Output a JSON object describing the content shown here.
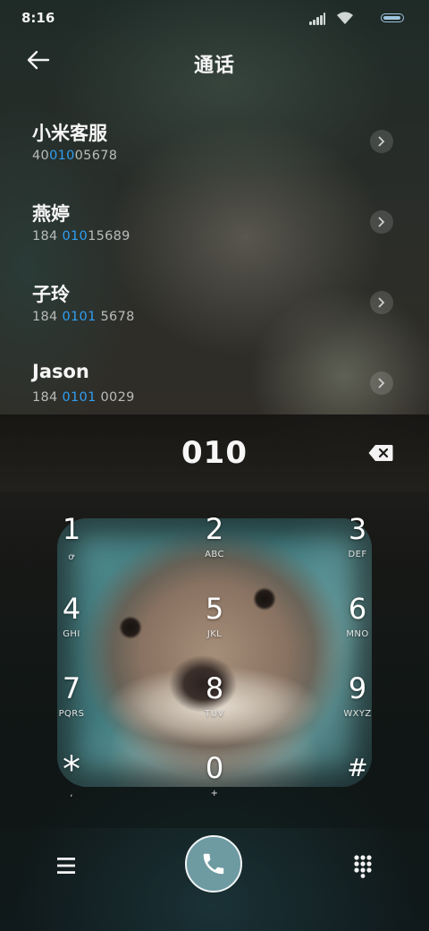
{
  "status_bar": {
    "time": "8:16",
    "icons": [
      "signal-icon",
      "wifi-icon",
      "battery-icon"
    ],
    "battery_color": "#9fc4df"
  },
  "header": {
    "title": "通话",
    "back_icon": "arrow-left-icon"
  },
  "contacts": [
    {
      "name": "小米客服",
      "number_pre": "40",
      "number_match": "010",
      "number_post": "05678"
    },
    {
      "name": "燕婷",
      "number_pre": "184 ",
      "number_match": "010",
      "number_post": "15689"
    },
    {
      "name": "子玲",
      "number_pre": "184 ",
      "number_match": "0101",
      "number_post": " 5678"
    },
    {
      "name": "Jason",
      "number_pre": "184 ",
      "number_match": "0101",
      "number_post": " 0029"
    }
  ],
  "match_color": "#2f9ef2",
  "dialer": {
    "number": "010",
    "backspace_icon": "backspace-icon"
  },
  "keypad": [
    {
      "digit": "1",
      "letters": "ꝍ"
    },
    {
      "digit": "2",
      "letters": "ABC"
    },
    {
      "digit": "3",
      "letters": "DEF"
    },
    {
      "digit": "4",
      "letters": "GHI"
    },
    {
      "digit": "5",
      "letters": "JKL"
    },
    {
      "digit": "6",
      "letters": "MNO"
    },
    {
      "digit": "7",
      "letters": "PQRS"
    },
    {
      "digit": "8",
      "letters": "TUV"
    },
    {
      "digit": "9",
      "letters": "WXYZ"
    },
    {
      "digit": "*",
      "letters": ","
    },
    {
      "digit": "0",
      "letters": "+"
    },
    {
      "digit": "#",
      "letters": ""
    }
  ],
  "bottom_bar": {
    "menu_icon": "menu-icon",
    "call_icon": "phone-icon",
    "call_color": "#6e9aa2",
    "dialpad_icon": "dialpad-icon"
  }
}
